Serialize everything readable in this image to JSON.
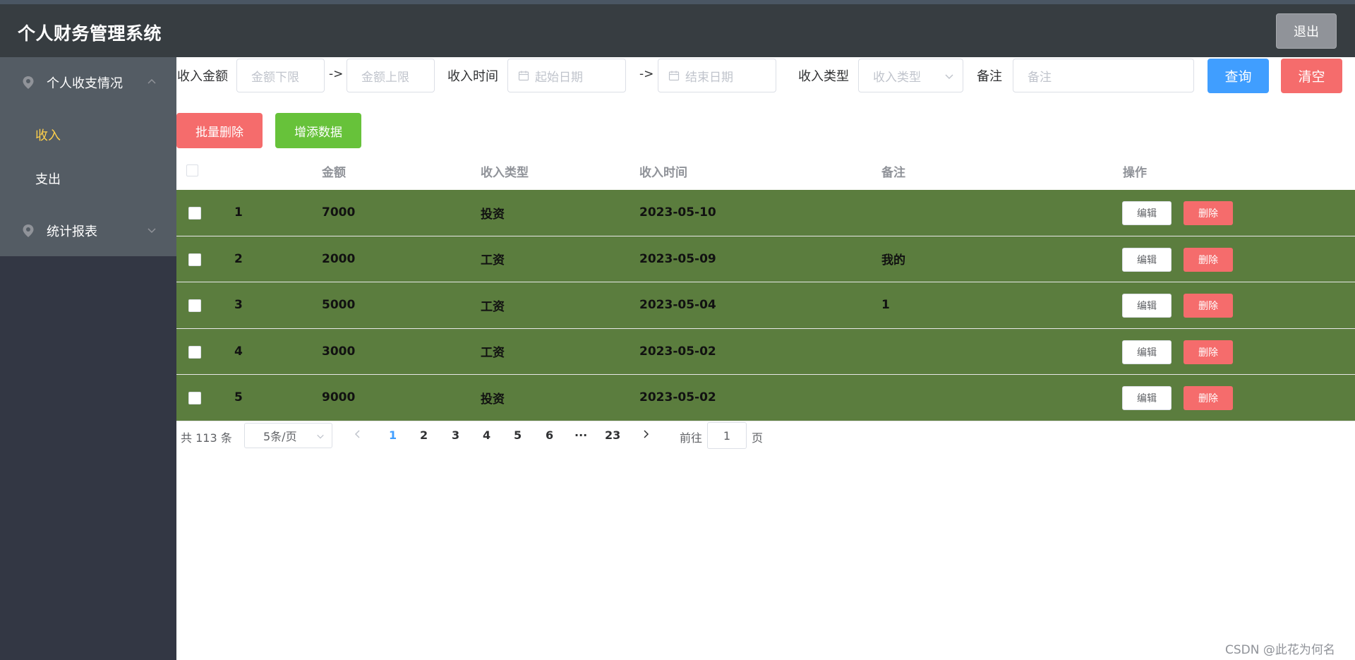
{
  "app": {
    "title": "个人财务管理系统",
    "logout_label": "退出"
  },
  "sidebar": {
    "groups": [
      {
        "label": "个人收支情况",
        "expanded": true
      },
      {
        "label": "统计报表",
        "expanded": false
      }
    ],
    "items": [
      {
        "label": "收入",
        "active": true
      },
      {
        "label": "支出",
        "active": false
      }
    ],
    "active_color": "#ffd04b"
  },
  "filters": {
    "amount_label": "收入金额",
    "amount_min_placeholder": "金额下限",
    "amount_max_placeholder": "金额上限",
    "range_separator": "->",
    "time_label": "收入时间",
    "start_date_placeholder": "起始日期",
    "end_date_placeholder": "结束日期",
    "type_label": "收入类型",
    "type_placeholder": "收入类型",
    "note_label": "备注",
    "note_placeholder": "备注",
    "query_label": "查询",
    "clear_label": "清空"
  },
  "actions": {
    "batch_delete_label": "批量删除",
    "add_label": "增添数据"
  },
  "table": {
    "headers": {
      "amount": "金额",
      "type": "收入类型",
      "time": "收入时间",
      "note": "备注",
      "ops": "操作"
    },
    "edit_label": "编辑",
    "delete_label": "删除",
    "row_color": "#5b7d3e",
    "rows": [
      {
        "index": "1",
        "amount": "7000",
        "type": "投资",
        "time": "2023-05-10",
        "note": ""
      },
      {
        "index": "2",
        "amount": "2000",
        "type": "工资",
        "time": "2023-05-09",
        "note": "我的"
      },
      {
        "index": "3",
        "amount": "5000",
        "type": "工资",
        "time": "2023-05-04",
        "note": "1"
      },
      {
        "index": "4",
        "amount": "3000",
        "type": "工资",
        "time": "2023-05-02",
        "note": ""
      },
      {
        "index": "5",
        "amount": "9000",
        "type": "投资",
        "time": "2023-05-02",
        "note": ""
      }
    ]
  },
  "pagination": {
    "total_text": "共 113 条",
    "page_size_label": "5条/页",
    "pages": [
      "1",
      "2",
      "3",
      "4",
      "5",
      "6",
      "···",
      "23"
    ],
    "current_page": "1",
    "goto_label": "前往",
    "goto_value": "1",
    "goto_suffix": "页"
  },
  "watermark": "CSDN @此花为何名"
}
